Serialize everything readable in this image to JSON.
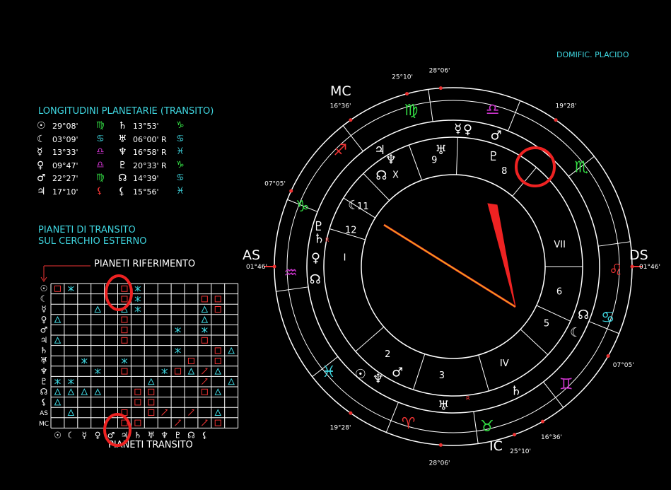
{
  "house_system": "DOMIFIC. PLACIDO",
  "longitudes": {
    "title": "LONGITUDINI PLANETARIE (TRANSITO)",
    "rows": [
      {
        "p": "☉",
        "v": "29°08'",
        "s": "♍",
        "sc": "#33dd44",
        "p2": "♄",
        "v2": "13°53'",
        "s2": "♑",
        "sc2": "#33dd44"
      },
      {
        "p": "☾",
        "v": "03°09'",
        "s": "♋",
        "sc": "#3fd6e0",
        "p2": "♅",
        "v2": "06°00' R",
        "s2": "♋",
        "sc2": "#3fd6e0"
      },
      {
        "p": "☿",
        "v": "13°33'",
        "s": "♎",
        "sc": "#cc33cc",
        "p2": "♆",
        "v2": "16°58' R",
        "s2": "♓",
        "sc2": "#3fd6e0"
      },
      {
        "p": "♀",
        "v": "09°47'",
        "s": "♎",
        "sc": "#cc33cc",
        "p2": "♇",
        "v2": "20°33' R",
        "s2": "♑",
        "sc2": "#33dd44"
      },
      {
        "p": "♂",
        "v": "22°27'",
        "s": "♍",
        "sc": "#33dd44",
        "p2": "☊",
        "v2": "14°39'",
        "s2": "♋",
        "sc2": "#3fd6e0"
      },
      {
        "p": "♃",
        "v": "17°10'",
        "s": "⚸",
        "sc": "#ee3333",
        "p2": "⚸",
        "v2": "15°56'",
        "s2": "♓",
        "sc2": "#3fd6e0"
      }
    ]
  },
  "transit_note": {
    "line1": "PIANETI DI TRANSITO",
    "line2": "SUL CERCHIO ESTERNO"
  },
  "grid": {
    "ref_label": "PIANETI RIFERIMENTO",
    "transit_label": "PIANETI TRANSITO",
    "row_labels": [
      "☉",
      "☾",
      "☿",
      "♀",
      "♂",
      "♃",
      "♄",
      "♅",
      "♆",
      "♇",
      "☊",
      "⚸",
      "AS",
      "MC"
    ],
    "col_labels": [
      "☉",
      "☾",
      "☿",
      "♀",
      "♂",
      "♃",
      "♄",
      "♅",
      "♆",
      "♇",
      "☊",
      "⚸"
    ],
    "cells": [
      [
        0,
        0,
        "sq"
      ],
      [
        0,
        1,
        "sx"
      ],
      [
        0,
        5,
        "sq"
      ],
      [
        0,
        6,
        "sx"
      ],
      [
        1,
        5,
        "sq"
      ],
      [
        1,
        6,
        "sx"
      ],
      [
        1,
        11,
        "sq"
      ],
      [
        1,
        12,
        "sq"
      ],
      [
        2,
        3,
        "tr"
      ],
      [
        2,
        5,
        "tr"
      ],
      [
        2,
        6,
        "sx"
      ],
      [
        2,
        11,
        "tr"
      ],
      [
        2,
        12,
        "sq"
      ],
      [
        3,
        0,
        "tr"
      ],
      [
        3,
        5,
        "sq"
      ],
      [
        3,
        11,
        "tr"
      ],
      [
        4,
        5,
        "sq"
      ],
      [
        4,
        9,
        "sx"
      ],
      [
        4,
        11,
        "sx"
      ],
      [
        5,
        0,
        "tr"
      ],
      [
        5,
        5,
        "sq"
      ],
      [
        5,
        11,
        "sq"
      ],
      [
        6,
        9,
        "sx"
      ],
      [
        6,
        12,
        "sq"
      ],
      [
        6,
        13,
        "tr"
      ],
      [
        7,
        2,
        "sx"
      ],
      [
        7,
        5,
        "sx"
      ],
      [
        7,
        10,
        "sq"
      ],
      [
        7,
        12,
        "sq"
      ],
      [
        8,
        3,
        "sx"
      ],
      [
        8,
        5,
        "sq"
      ],
      [
        8,
        8,
        "sx"
      ],
      [
        8,
        9,
        "sq"
      ],
      [
        8,
        10,
        "tr"
      ],
      [
        8,
        11,
        "op"
      ],
      [
        8,
        12,
        "tr"
      ],
      [
        9,
        0,
        "sx"
      ],
      [
        9,
        1,
        "sx"
      ],
      [
        9,
        7,
        "tr"
      ],
      [
        9,
        11,
        "op"
      ],
      [
        9,
        13,
        "tr"
      ],
      [
        10,
        0,
        "tr"
      ],
      [
        10,
        1,
        "tr"
      ],
      [
        10,
        2,
        "tr"
      ],
      [
        10,
        3,
        "tr"
      ],
      [
        10,
        6,
        "sq"
      ],
      [
        10,
        7,
        "sq"
      ],
      [
        10,
        11,
        "sq"
      ],
      [
        10,
        12,
        "tr"
      ],
      [
        11,
        0,
        "tr"
      ],
      [
        11,
        6,
        "sq"
      ],
      [
        11,
        7,
        "sq"
      ],
      [
        12,
        1,
        "tr"
      ],
      [
        12,
        5,
        "sq"
      ],
      [
        12,
        7,
        "sq"
      ],
      [
        12,
        8,
        "op"
      ],
      [
        12,
        10,
        "op"
      ],
      [
        12,
        12,
        "tr"
      ],
      [
        13,
        5,
        "sq"
      ],
      [
        13,
        6,
        "sq"
      ],
      [
        13,
        9,
        "op"
      ],
      [
        13,
        11,
        "op"
      ],
      [
        13,
        12,
        "sq"
      ]
    ]
  },
  "wheel": {
    "angle_labels": {
      "as": "AS",
      "ds": "DS",
      "mc": "MC",
      "ic": "IC"
    },
    "degree_marks": [
      {
        "deg": "28°06'",
        "ang": 94
      },
      {
        "deg": "19°28'",
        "ang": 55
      },
      {
        "deg": "01°46'",
        "ang": 0
      },
      {
        "deg": "07°05'",
        "ang": -30
      },
      {
        "deg": "16°36'",
        "ang": -60
      },
      {
        "deg": "25°10'",
        "ang": -70
      },
      {
        "deg": "28°06'",
        "ang": -94
      },
      {
        "deg": "19°28'",
        "ang": -125
      },
      {
        "deg": "01°46'",
        "ang": 180
      },
      {
        "deg": "07°05'",
        "ang": 155
      },
      {
        "deg": "16°36'",
        "ang": 125
      },
      {
        "deg": "25°10'",
        "ang": 105
      }
    ],
    "signs": [
      {
        "g": "♍",
        "c": "#33dd44",
        "ang": 105
      },
      {
        "g": "♎",
        "c": "#cc33cc",
        "ang": 76
      },
      {
        "g": "♏",
        "c": "#33dd44",
        "ang": 38
      },
      {
        "g": "♌",
        "c": "#ee3333",
        "ang": -1
      },
      {
        "g": "♋",
        "c": "#3fd6e0",
        "ang": -18
      },
      {
        "g": "♊",
        "c": "#cc33cc",
        "ang": -46
      },
      {
        "g": "♉",
        "c": "#33dd44",
        "ang": -78
      },
      {
        "g": "♈",
        "c": "#ee3333",
        "ang": -106
      },
      {
        "g": "♓",
        "c": "#3fd6e0",
        "ang": -140
      },
      {
        "g": "♒",
        "c": "#cc33cc",
        "ang": -178
      },
      {
        "g": "♑",
        "c": "#33dd44",
        "ang": 158
      },
      {
        "g": "♐",
        "c": "#ee3333",
        "ang": 134
      }
    ],
    "houses": [
      {
        "n": "9",
        "ang": 100
      },
      {
        "n": "8",
        "ang": 62
      },
      {
        "n": "VII",
        "ang": 12
      },
      {
        "n": "6",
        "ang": -13
      },
      {
        "n": "5",
        "ang": -31
      },
      {
        "n": "IV",
        "ang": -62
      },
      {
        "n": "3",
        "ang": -96
      },
      {
        "n": "2",
        "ang": -127
      },
      {
        "n": "I",
        "ang": 175
      },
      {
        "n": "12",
        "ang": 160
      },
      {
        "n": "11",
        "ang": 146
      },
      {
        "n": "X",
        "ang": 122
      }
    ],
    "retro": "R"
  }
}
